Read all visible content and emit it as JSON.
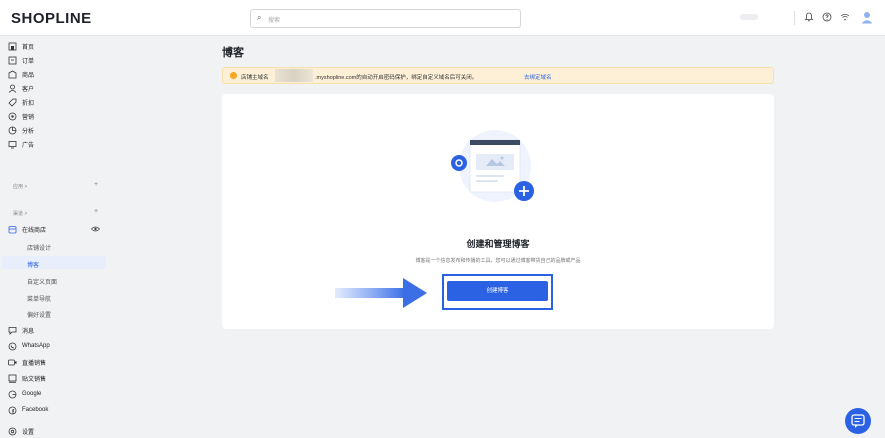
{
  "brand": {
    "logo_text": "SHOPLINE",
    "accent": "#2b62e3"
  },
  "search": {
    "placeholder": "搜索"
  },
  "sidebar": {
    "items_top": [
      {
        "label": "首页",
        "icon": "home-icon"
      },
      {
        "label": "订单",
        "icon": "order-icon"
      },
      {
        "label": "商品",
        "icon": "product-icon"
      },
      {
        "label": "客户",
        "icon": "customer-icon"
      },
      {
        "label": "折扣",
        "icon": "tag-icon"
      },
      {
        "label": "营销",
        "icon": "marketing-icon"
      },
      {
        "label": "分析",
        "icon": "analytics-icon"
      },
      {
        "label": "广告",
        "icon": "ads-icon"
      }
    ],
    "apps_section": "应用 >",
    "channels_section": "渠道 >",
    "online_store": "在线商店",
    "online_store_sub": [
      "店铺设计",
      "博客",
      "自定义页面",
      "菜单导航",
      "偏好设置"
    ],
    "items_bottom": [
      {
        "label": "消息",
        "icon": "message-icon"
      },
      {
        "label": "WhatsApp",
        "icon": "whatsapp-icon"
      },
      {
        "label": "直播销售",
        "icon": "live-icon"
      },
      {
        "label": "贴文销售",
        "icon": "post-icon"
      },
      {
        "label": "Google",
        "icon": "google-icon"
      },
      {
        "label": "Facebook",
        "icon": "facebook-icon"
      },
      {
        "label": "设置",
        "icon": "settings-icon"
      }
    ]
  },
  "main": {
    "title": "博客",
    "banner": {
      "prefix": "店铺主域名",
      "text": ".myshopline.com的自动开启密码保护，绑定自定义域名后可关闭。",
      "link": "去绑定域名"
    },
    "empty_state": {
      "title": "创建和管理博客",
      "desc": "博客是一个信息发布和传播的工具，您可以通过博客带货自己的品牌或产品",
      "button": "创建博客"
    }
  }
}
